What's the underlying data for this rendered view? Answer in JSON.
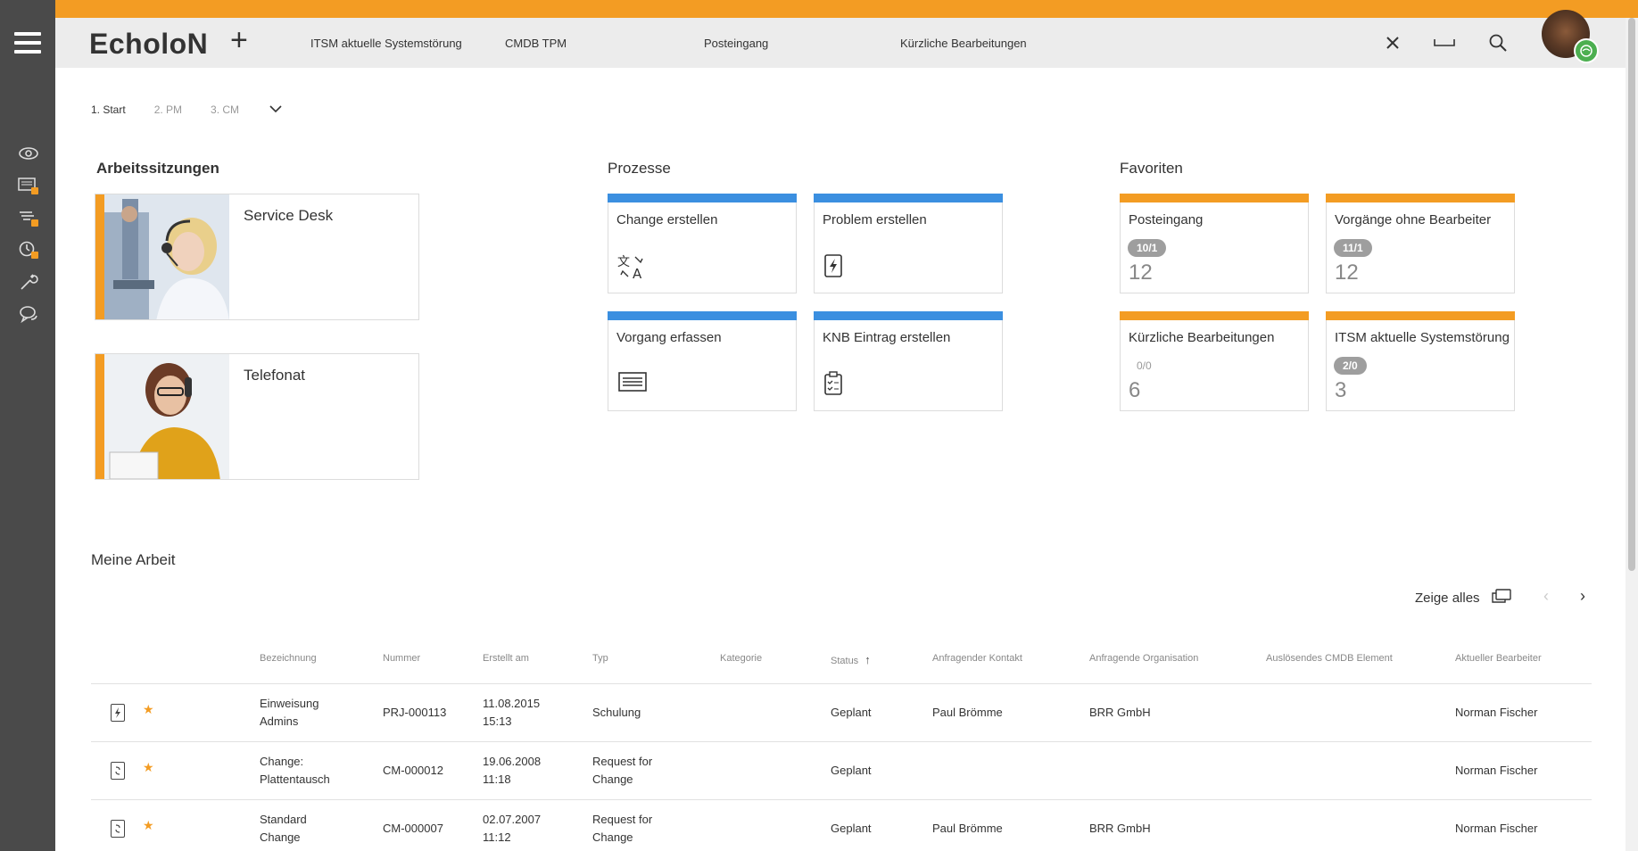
{
  "header": {
    "logo": "EcholoN",
    "tabs": [
      {
        "label": "ITSM aktuelle Systemstörung"
      },
      {
        "label": "CMDB TPM"
      },
      {
        "label": "Posteingang"
      },
      {
        "label": "Kürzliche Bearbeitungen"
      }
    ]
  },
  "breadcrumb": [
    "1. Start",
    "2. PM",
    "3. CM"
  ],
  "sessions": {
    "title": "Arbeitssitzungen",
    "items": [
      {
        "label": "Service Desk"
      },
      {
        "label": "Telefonat"
      }
    ]
  },
  "processes": {
    "title": "Prozesse",
    "accent": "#3b8fe0",
    "items": [
      {
        "label": "Change erstellen",
        "icon": "translate-icon"
      },
      {
        "label": "Problem erstellen",
        "icon": "bolt-document-icon"
      },
      {
        "label": "Vorgang erfassen",
        "icon": "list-card-icon"
      },
      {
        "label": "KNB Eintrag erstellen",
        "icon": "clipboard-checklist-icon"
      }
    ]
  },
  "favorites": {
    "title": "Favoriten",
    "accent": "#f39c23",
    "items": [
      {
        "label": "Posteingang",
        "badge": "10/1",
        "count": "12"
      },
      {
        "label": "Vorgänge ohne Bearbeiter",
        "badge": "11/1",
        "count": "12"
      },
      {
        "label": "Kürzliche Bearbeitungen",
        "badge": "0/0",
        "count": "6"
      },
      {
        "label": "ITSM aktuelle Systemstörung",
        "badge": "2/0",
        "count": "3"
      }
    ]
  },
  "work": {
    "title": "Meine Arbeit",
    "show_all": "Zeige alles",
    "columns": [
      "Bezeichnung",
      "Nummer",
      "Erstellt am",
      "Typ",
      "Kategorie",
      "Status",
      "Anfragender Kontakt",
      "Anfragende Organisation",
      "Auslösendes CMDB Element",
      "Aktueller Bearbeiter"
    ],
    "rows": [
      {
        "name1": "Einweisung",
        "name2": "Admins",
        "number": "PRJ-000113",
        "date": "11.08.2015",
        "time": "15:13",
        "type1": "Schulung",
        "type2": "",
        "status": "Geplant",
        "contact": "Paul Brömme",
        "org": "BRR GmbH",
        "assignee": "Norman Fischer"
      },
      {
        "name1": "Change:",
        "name2": "Plattentausch",
        "number": "CM-000012",
        "date": "19.06.2008",
        "time": "11:18",
        "type1": "Request for",
        "type2": "Change",
        "status": "Geplant",
        "contact": "",
        "org": "",
        "assignee": "Norman Fischer"
      },
      {
        "name1": "Standard",
        "name2": "Change",
        "number": "CM-000007",
        "date": "02.07.2007",
        "time": "11:12",
        "type1": "Request for",
        "type2": "Change",
        "status": "Geplant",
        "contact": "Paul Brömme",
        "org": "BRR GmbH",
        "assignee": "Norman Fischer"
      }
    ]
  }
}
